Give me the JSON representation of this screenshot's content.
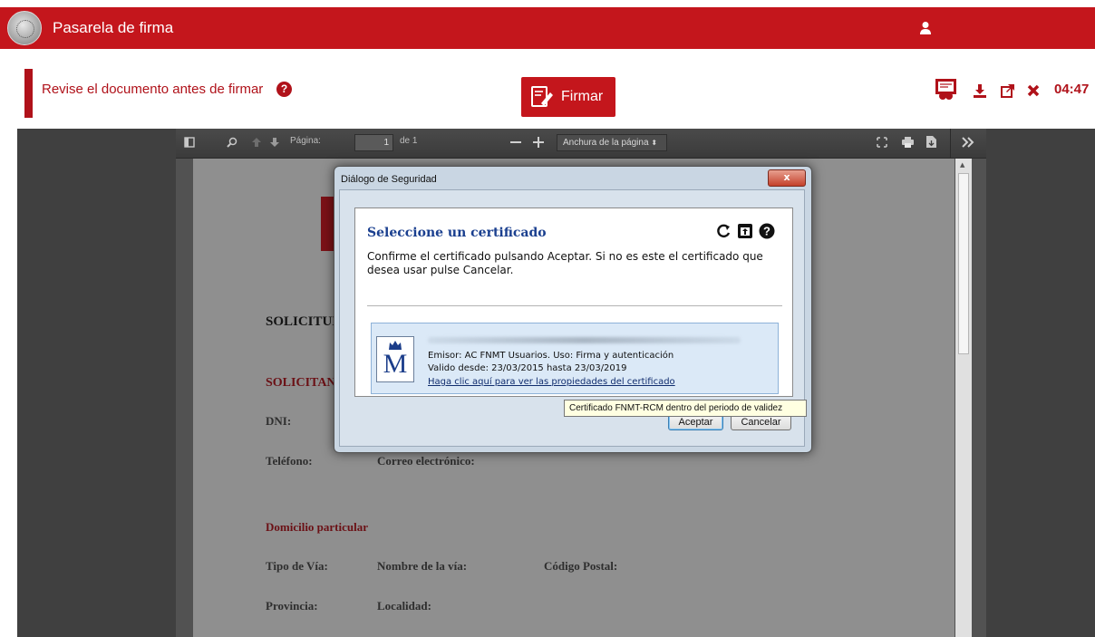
{
  "header": {
    "app_title": "Pasarela de firma"
  },
  "action_bar": {
    "review_text": "Revise el documento antes de firmar",
    "help": "?",
    "sign_label": "Firmar",
    "time": "04:47"
  },
  "pdf_toolbar": {
    "page_label": "Página:",
    "page_value": "1",
    "page_of": "de 1",
    "zoom_value": "Anchura de la página",
    "icons": [
      "sidebar-toggle-icon",
      "search-icon",
      "previous-page-icon",
      "next-page-icon",
      "zoom-out-icon",
      "zoom-in-icon",
      "fullscreen-icon",
      "print-icon",
      "download-icon",
      "more-tools-icon"
    ]
  },
  "document": {
    "heading": "SOLICITUD",
    "applicant_section": "SOLICITANT",
    "dni_label": "DNI:",
    "phone_label": "Teléfono:",
    "email_label": "Correo electrónico:",
    "address_section": "Domicilio particular",
    "street_type_label": "Tipo de Vía:",
    "street_name_label": "Nombre de la vía:",
    "postal_code_label": "Código Postal:",
    "province_label": "Provincia:",
    "locality_label": "Localidad:"
  },
  "dialog": {
    "window_title": "Diálogo de Seguridad",
    "close": "x",
    "title": "Seleccione un certificado",
    "description": "Confirme el certificado pulsando Aceptar. Si no es este el certificado que desea usar pulse Cancelar.",
    "certificate": {
      "issuer_line": "Emisor: AC FNMT Usuarios. Uso: Firma y autenticación",
      "validity_line": "Valido desde: 23/03/2015 hasta 23/03/2019",
      "properties_link": "Haga clic aquí para ver las propiedades del certificado",
      "logo_letter": "M"
    },
    "tooltip": "Certificado FNMT-RCM dentro del periodo de validez",
    "accept_label": "Aceptar",
    "cancel_label": "Cancelar"
  },
  "colors": {
    "brand_red": "#c4161c",
    "dark_red": "#b0121a",
    "link_blue": "#1a3f8f"
  }
}
